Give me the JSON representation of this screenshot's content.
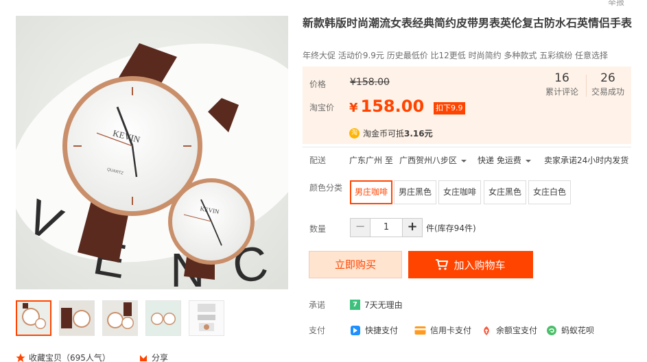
{
  "header": {
    "report": "举报"
  },
  "product": {
    "title": "新款韩版时尚潮流女表经典简约皮带男表英伦复古防水石英情侣手表",
    "subtitle": "年终大促 活动价9.9元 历史最低价 比12更低 时尚简约 多种款式 五彩缤纷 任意选择"
  },
  "price": {
    "label": "价格",
    "original": "¥158.00",
    "taobao_label": "淘宝价",
    "yen": "¥",
    "current": "158.00",
    "promo_tag": "扣下9.9",
    "reviews_count": "16",
    "reviews_label": "累计评论",
    "trades_count": "26",
    "trades_label": "交易成功",
    "coin_icon": "淘",
    "coin_text": "淘金币可抵",
    "coin_amount": "3.16元"
  },
  "shipping": {
    "label": "配送",
    "from": "广东广州 至",
    "to": "广西贺州八步区",
    "method": "快递 免运费",
    "promise": "卖家承诺24小时内发货"
  },
  "sku": {
    "label": "颜色分类",
    "options": [
      "男庄咖啡",
      "男庄黑色",
      "女庄咖啡",
      "女庄黑色",
      "女庄白色"
    ],
    "selected_index": 0
  },
  "quantity": {
    "label": "数量",
    "minus": "−",
    "value": "1",
    "plus": "+",
    "stock": "件(库存94件)"
  },
  "actions": {
    "buy_now": "立即购买",
    "add_to_cart": "加入购物车"
  },
  "service": {
    "promise_label": "承诺",
    "promise_icon": "7",
    "promise_text": "7天无理由",
    "pay_label": "支付",
    "payments": [
      {
        "icon": "quickpay-icon",
        "text": "快捷支付"
      },
      {
        "icon": "credit-card-icon",
        "text": "信用卡支付"
      },
      {
        "icon": "yuebao-icon",
        "text": "余额宝支付"
      },
      {
        "icon": "huabei-icon",
        "text": "蚂蚁花呗"
      }
    ]
  },
  "gallery": {
    "collect": "收藏宝贝（695人气）",
    "share": "分享",
    "thumb_count": 5,
    "watch_brand": "KEVIN",
    "movement": "QUARTZ"
  },
  "colors": {
    "accent": "#ff4400",
    "price_bg": "#fff2e8",
    "strap": "#5a2a1e",
    "gold": "#c98f6a"
  }
}
